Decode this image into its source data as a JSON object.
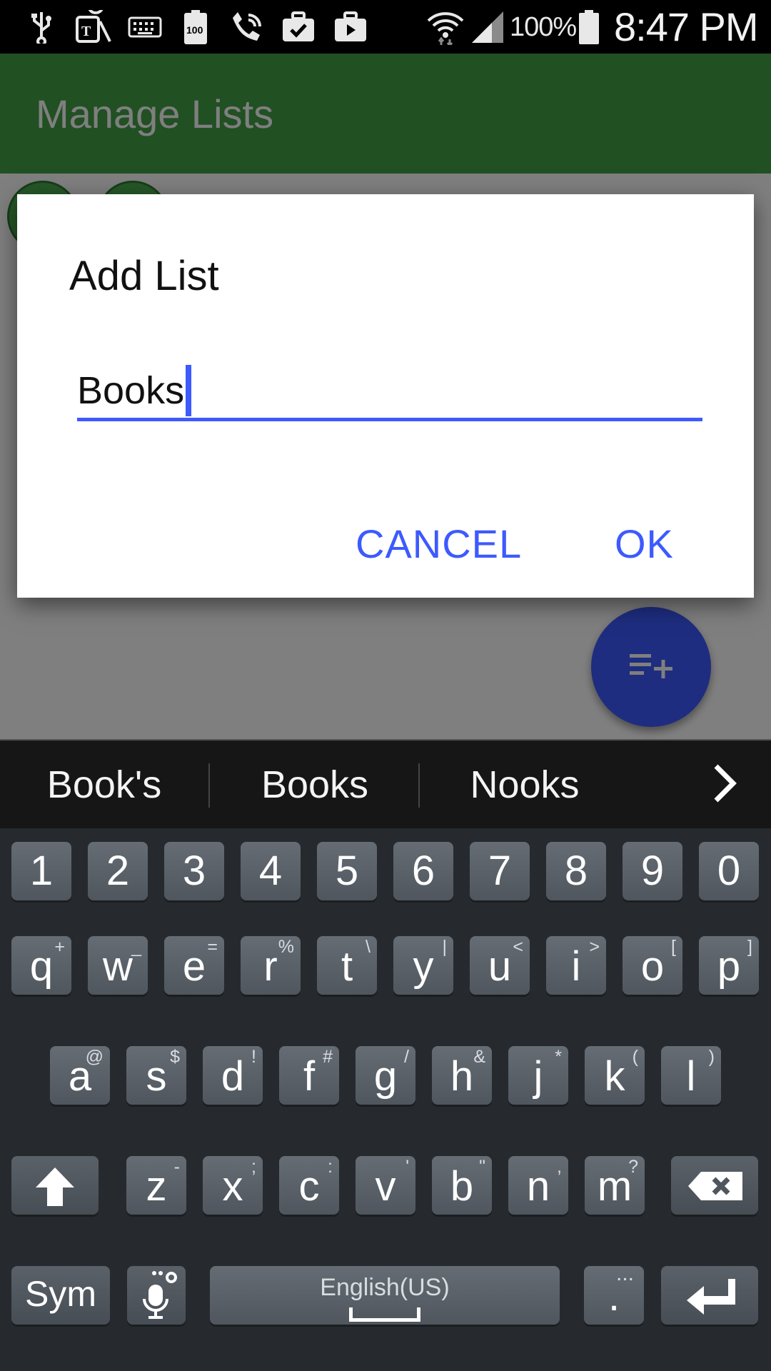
{
  "status_bar": {
    "icons": [
      "usb-icon",
      "tmobile-icon",
      "keyboard-icon",
      "battery-100-icon",
      "wifi-calling-icon",
      "briefcase-check-icon",
      "briefcase-play-icon",
      "wifi-icon",
      "signal-icon",
      "battery-icon"
    ],
    "battery_percent": "100%",
    "time": "8:47 PM"
  },
  "app": {
    "title": "Manage Lists",
    "toolbar_color": "#43a047",
    "fab_icon": "playlist-add-icon",
    "accent_color": "#3d5afe"
  },
  "dialog": {
    "title": "Add List",
    "input_value": "Books",
    "cancel_label": "CANCEL",
    "ok_label": "OK"
  },
  "keyboard": {
    "suggestions": [
      "Book's",
      "Books",
      "Nooks"
    ],
    "number_row": [
      "1",
      "2",
      "3",
      "4",
      "5",
      "6",
      "7",
      "8",
      "9",
      "0"
    ],
    "row1": [
      {
        "key": "q",
        "alt": "+"
      },
      {
        "key": "w",
        "alt": "_"
      },
      {
        "key": "e",
        "alt": "="
      },
      {
        "key": "r",
        "alt": "%"
      },
      {
        "key": "t",
        "alt": "\\"
      },
      {
        "key": "y",
        "alt": "|"
      },
      {
        "key": "u",
        "alt": "<"
      },
      {
        "key": "i",
        "alt": ">"
      },
      {
        "key": "o",
        "alt": "["
      },
      {
        "key": "p",
        "alt": "]"
      }
    ],
    "row2": [
      {
        "key": "a",
        "alt": "@"
      },
      {
        "key": "s",
        "alt": "$"
      },
      {
        "key": "d",
        "alt": "!"
      },
      {
        "key": "f",
        "alt": "#"
      },
      {
        "key": "g",
        "alt": "/"
      },
      {
        "key": "h",
        "alt": "&"
      },
      {
        "key": "j",
        "alt": "*"
      },
      {
        "key": "k",
        "alt": "("
      },
      {
        "key": "l",
        "alt": ")"
      }
    ],
    "row3": [
      {
        "key": "z",
        "alt": "-"
      },
      {
        "key": "x",
        "alt": ";"
      },
      {
        "key": "c",
        "alt": ":"
      },
      {
        "key": "v",
        "alt": "'"
      },
      {
        "key": "b",
        "alt": "\""
      },
      {
        "key": "n",
        "alt": ","
      },
      {
        "key": "m",
        "alt": "?"
      }
    ],
    "sym_label": "Sym",
    "space_label": "English(US)",
    "period_label": ".",
    "period_alt": "...",
    "shift_icon": "shift-arrow-icon",
    "backspace_icon": "backspace-icon",
    "enter_icon": "enter-icon",
    "mic_icon": "microphone-settings-icon"
  }
}
